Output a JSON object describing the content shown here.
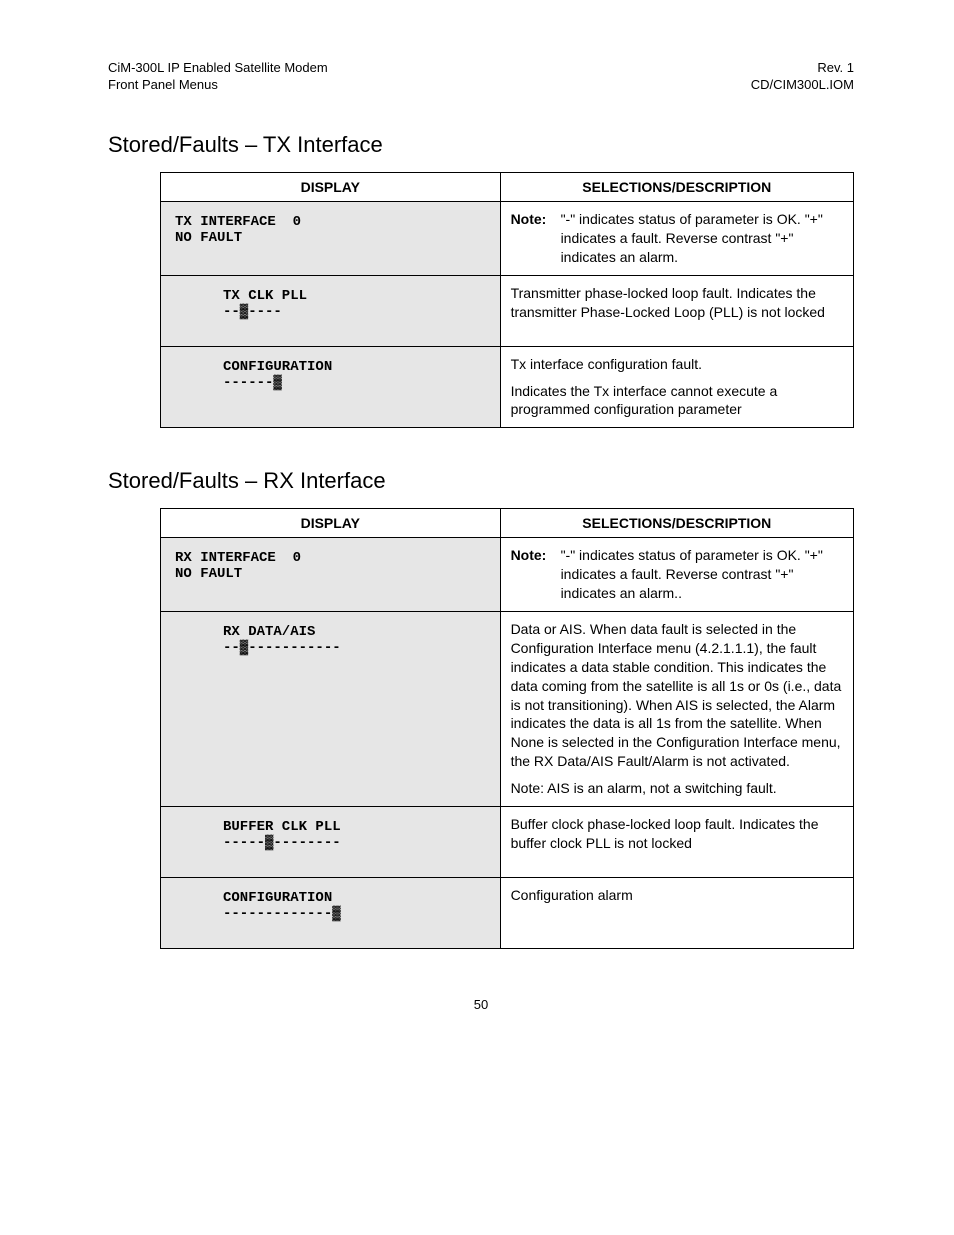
{
  "header": {
    "left1": "CiM-300L IP Enabled Satellite Modem",
    "left2": "Front Panel Menus",
    "right1": "Rev. 1",
    "right2": "CD/CIM300L.IOM"
  },
  "section1": {
    "title": "Stored/Faults – TX Interface",
    "col_display": "DISPLAY",
    "col_desc": "SELECTIONS/DESCRIPTION",
    "rows": [
      {
        "display_line1": "TX INTERFACE  0",
        "display_line2": "NO FAULT",
        "note_label": "Note:",
        "note_body": "\"-\" indicates status of parameter is OK. \"+\" indicates a fault. Reverse contrast \"+\" indicates an alarm."
      },
      {
        "display_line1": "TX CLK PLL",
        "display_line2": "--▓----",
        "desc": "Transmitter phase-locked loop fault. Indicates the transmitter Phase-Locked Loop (PLL) is not locked"
      },
      {
        "display_line1": "CONFIGURATION",
        "display_line2": "------▓",
        "desc": "Tx interface configuration fault.",
        "desc2": "Indicates the Tx interface cannot execute a programmed configuration parameter"
      }
    ]
  },
  "section2": {
    "title": "Stored/Faults – RX Interface",
    "col_display": "DISPLAY",
    "col_desc": "SELECTIONS/DESCRIPTION",
    "rows": [
      {
        "display_line1": "RX INTERFACE  0",
        "display_line2": "NO FAULT",
        "note_label": "Note:",
        "note_body": "\"-\" indicates status of parameter is OK. \"+\" indicates a fault. Reverse contrast \"+\" indicates an alarm.."
      },
      {
        "display_line1": "RX DATA/AIS",
        "display_line2": "--▓-----------",
        "desc": "Data or AIS. When data fault is selected in the Configuration Interface menu (4.2.1.1.1), the fault indicates a data stable condition. This indicates the data coming from the satellite is all 1s or 0s (i.e., data is not transitioning). When AIS is selected, the Alarm indicates the data is all 1s from the satellite. When None is selected in the Configuration Interface menu, the RX Data/AIS Fault/Alarm is not activated.",
        "desc2": "Note: AIS is an alarm, not a switching fault."
      },
      {
        "display_line1": "BUFFER CLK PLL",
        "display_line2": "-----▓--------",
        "desc": "Buffer clock phase-locked loop fault. Indicates the buffer clock PLL is not locked"
      },
      {
        "display_line1": "CONFIGURATION",
        "display_line2": "-------------▓",
        "desc": "Configuration alarm"
      }
    ]
  },
  "footer": {
    "page": "50"
  }
}
